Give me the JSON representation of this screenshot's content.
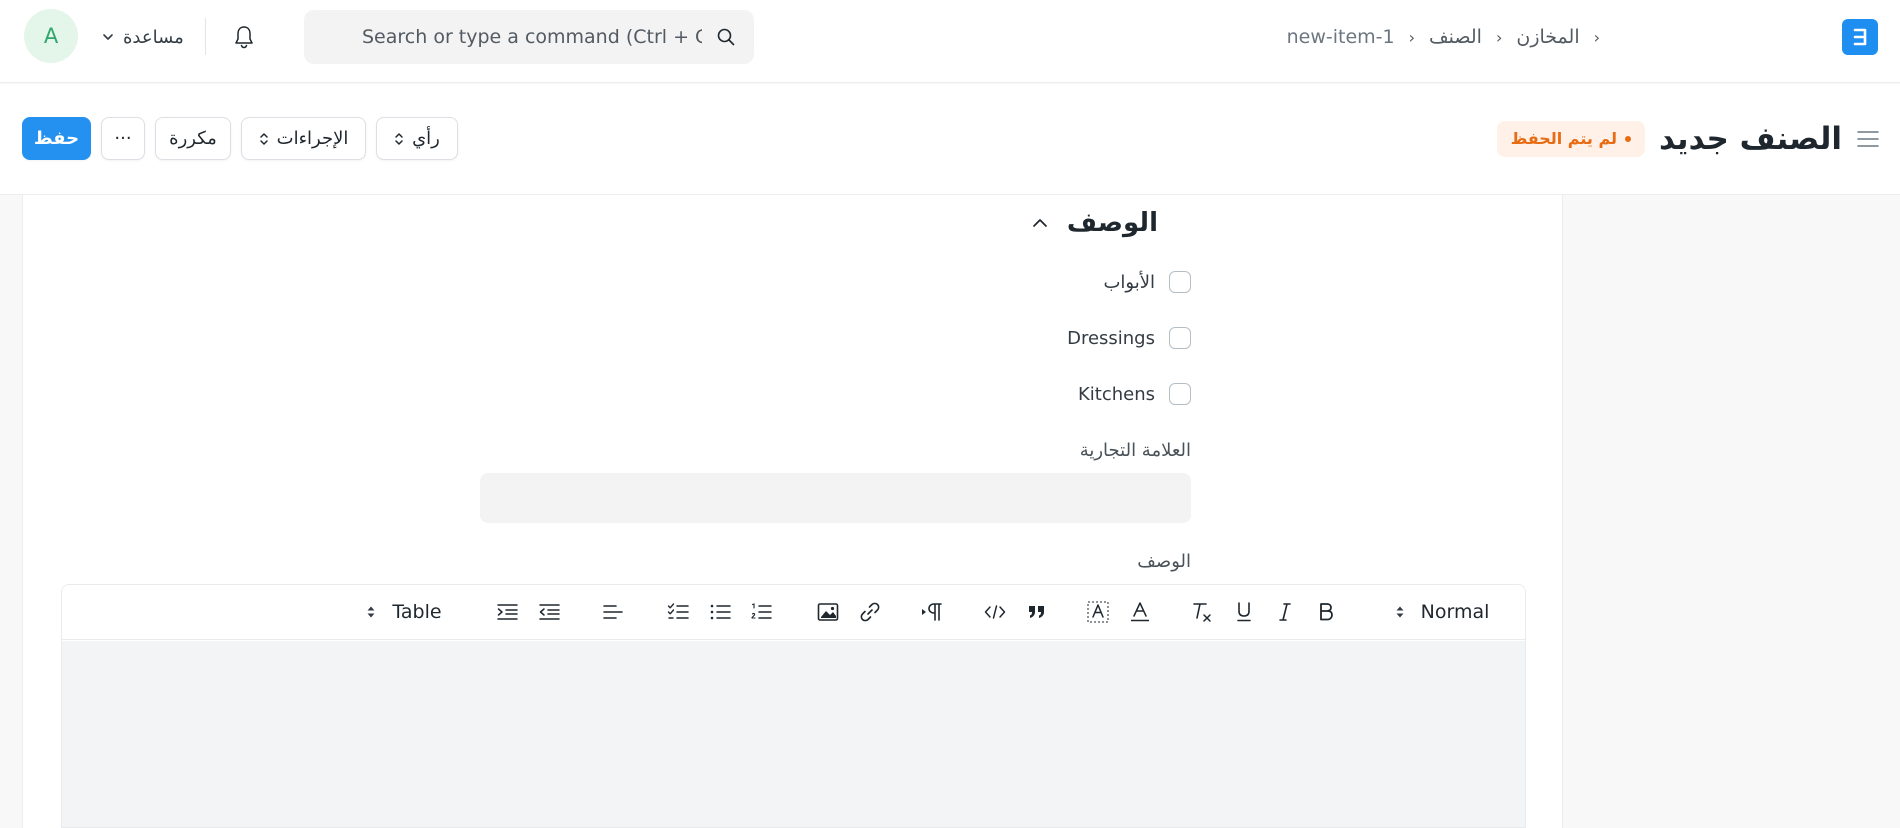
{
  "navbar": {
    "avatar_initial": "A",
    "help_label": "مساعدة",
    "search_placeholder": "Search or type a command (Ctrl + G)",
    "breadcrumbs": [
      "المخازن",
      "الصنف",
      "new-item-1"
    ],
    "brand_color": "#1f8ef1"
  },
  "page_head": {
    "title": "الصنف جديد",
    "status": "لم يتم الحفظ",
    "save_label": "حفظ",
    "more_label": "···",
    "duplicate_label": "مكررة",
    "actions_label": "الإجراءات",
    "view_label": "رأي",
    "accent_color": "#2490ef",
    "status_color": "#e86c13"
  },
  "form": {
    "section_title": "الوصف",
    "checkboxes": [
      {
        "label": "الأبواب",
        "checked": false
      },
      {
        "label": "Dressings",
        "checked": false
      },
      {
        "label": "Kitchens",
        "checked": false
      }
    ],
    "brand_label": "العلامة التجارية",
    "brand_value": "",
    "description_label": "الوصف"
  },
  "editor": {
    "header_style": "Normal",
    "table_label": "Table",
    "icons": [
      "sort-icon",
      "bold-icon",
      "italic-icon",
      "underline-icon",
      "clear-format-icon",
      "text-color-icon",
      "background-color-icon",
      "blockquote-icon",
      "code-icon",
      "paragraph-direction-icon",
      "link-icon",
      "image-icon",
      "ordered-list-icon",
      "bullet-list-icon",
      "check-list-icon",
      "align-icon",
      "outdent-icon",
      "indent-icon",
      "table-sort-icon"
    ]
  }
}
